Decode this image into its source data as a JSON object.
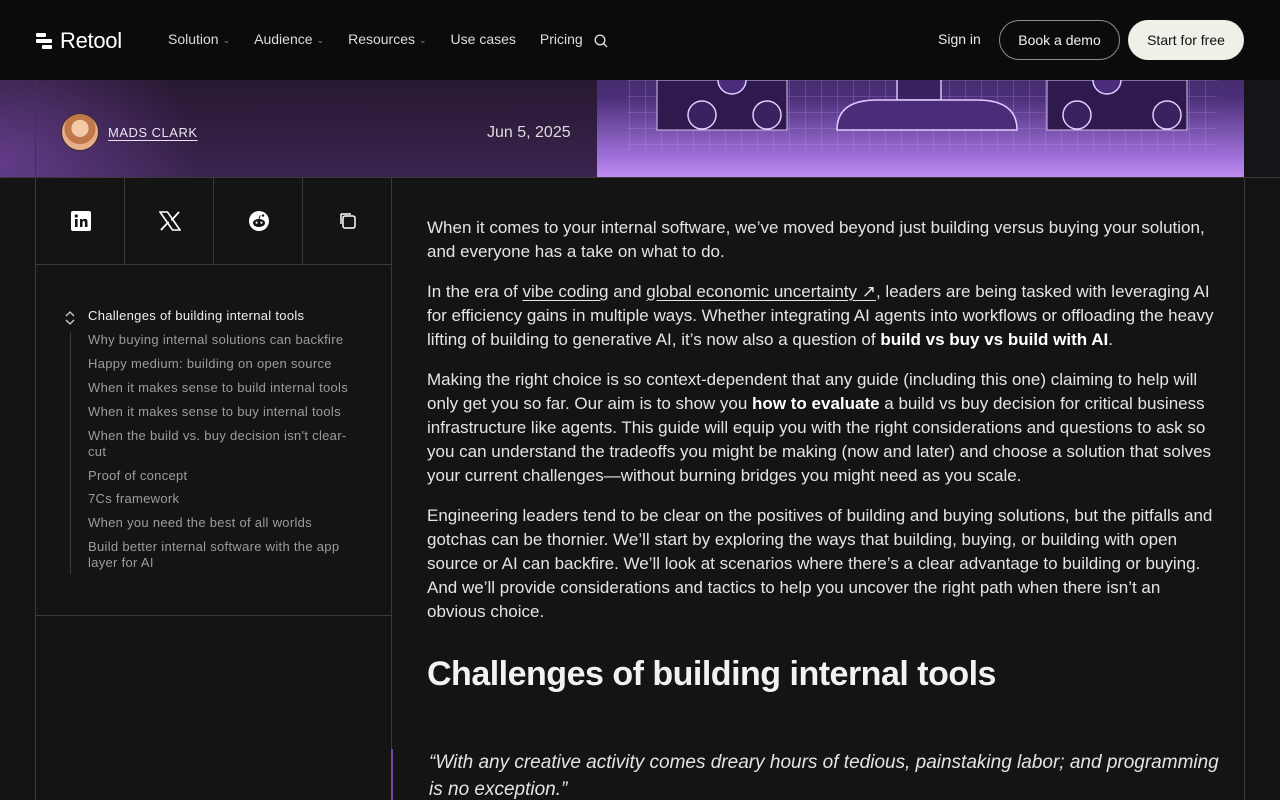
{
  "nav": {
    "brand": "Retool",
    "links": [
      {
        "label": "Solution",
        "dropdown": true
      },
      {
        "label": "Audience",
        "dropdown": true
      },
      {
        "label": "Resources",
        "dropdown": true
      },
      {
        "label": "Use cases",
        "dropdown": false
      },
      {
        "label": "Pricing",
        "dropdown": false
      }
    ],
    "sign_in": "Sign in",
    "book_demo": "Book a demo",
    "start_free": "Start for free"
  },
  "post": {
    "author": "MADS CLARK",
    "date": "Jun 5, 2025"
  },
  "share": {
    "icons": [
      "linkedin-icon",
      "x-icon",
      "reddit-icon",
      "copy-link-icon"
    ]
  },
  "toc": {
    "active": "Challenges of building internal tools",
    "items": [
      "Why buying internal solutions can backfire",
      "Happy medium: building on open source",
      "When it makes sense to build internal tools",
      "When it makes sense to buy internal tools",
      "When the build vs. buy decision isn't clear-cut",
      "Proof of concept",
      "7Cs framework",
      "When you need the best of all worlds",
      "Build better internal software with the app layer for AI"
    ]
  },
  "article": {
    "p1": "When it comes to your internal software, we’ve moved beyond just building versus buying your solution, and everyone has a take on what to do.",
    "p2_a": "In the era of ",
    "p2_link1": "vibe coding",
    "p2_b": " and ",
    "p2_link2": "global economic uncertainty ↗",
    "p2_c": ", leaders are being tasked with leveraging AI for efficiency gains in multiple ways. Whether integrating AI agents into workflows or offloading the heavy lifting of building to generative AI, it’s now also a question of ",
    "p2_bold": "build vs buy vs build with AI",
    "p2_d": ".",
    "p3_a": "Making the right choice is so context-dependent that any guide (including this one) claiming to help will only get you so far. Our aim is to show you ",
    "p3_bold": "how to evaluate",
    "p3_b": " a build vs buy decision for critical business infrastructure like agents. This guide will equip you with the right considerations and questions to ask so you can understand the tradeoffs you might be making (now and later) and choose a solution that solves your current challenges—without burning bridges you might need as you scale.",
    "p4": "Engineering leaders tend to be clear on the positives of building and buying solutions, but the pitfalls and gotchas can be thornier. We’ll start by exploring the ways that building, buying, or building with open source or AI can backfire. We’ll look at scenarios where there’s a clear advantage to building or buying. And we’ll provide considerations and tactics to help you uncover the right path when there isn’t an obvious choice.",
    "h2": "Challenges of building internal tools",
    "quote": "“With any creative activity comes dreary hours of tedious, painstaking labor; and programming is no exception.”"
  },
  "colors": {
    "accent_purple": "#a373dd",
    "cta_bg": "#f0efe8",
    "background": "#141414"
  }
}
